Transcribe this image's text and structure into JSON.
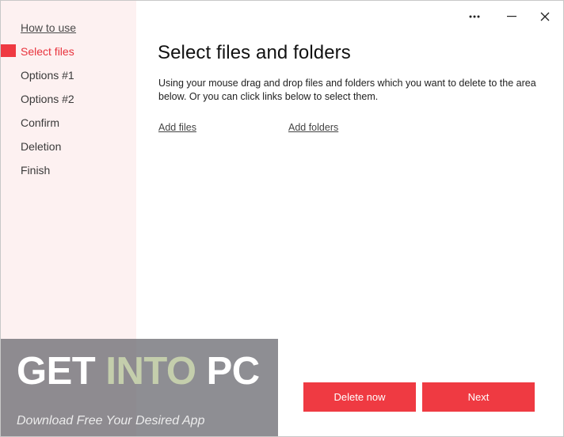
{
  "window": {
    "controls": {
      "more_icon": "more-dots-icon",
      "minimize_icon": "minimize-icon",
      "close_icon": "close-icon"
    }
  },
  "sidebar": {
    "items": [
      {
        "label": "How to use"
      },
      {
        "label": "Select files"
      },
      {
        "label": "Options #1"
      },
      {
        "label": "Options #2"
      },
      {
        "label": "Confirm"
      },
      {
        "label": "Deletion"
      },
      {
        "label": "Finish"
      }
    ],
    "active_index": 1
  },
  "main": {
    "title": "Select files and folders",
    "description": "Using your mouse drag and drop files and folders which you want to delete to the area below. Or you can click links below to select them.",
    "add_files": "Add files",
    "add_folders": "Add folders"
  },
  "buttons": {
    "delete_now": "Delete now",
    "next": "Next"
  },
  "watermark": {
    "brand_part1": "GET ",
    "brand_part2": "INTO",
    "brand_part3": " PC",
    "tagline": "Download Free Your Desired App"
  },
  "colors": {
    "accent": "#ef3a42",
    "sidebar_bg": "#fdf1f1"
  }
}
